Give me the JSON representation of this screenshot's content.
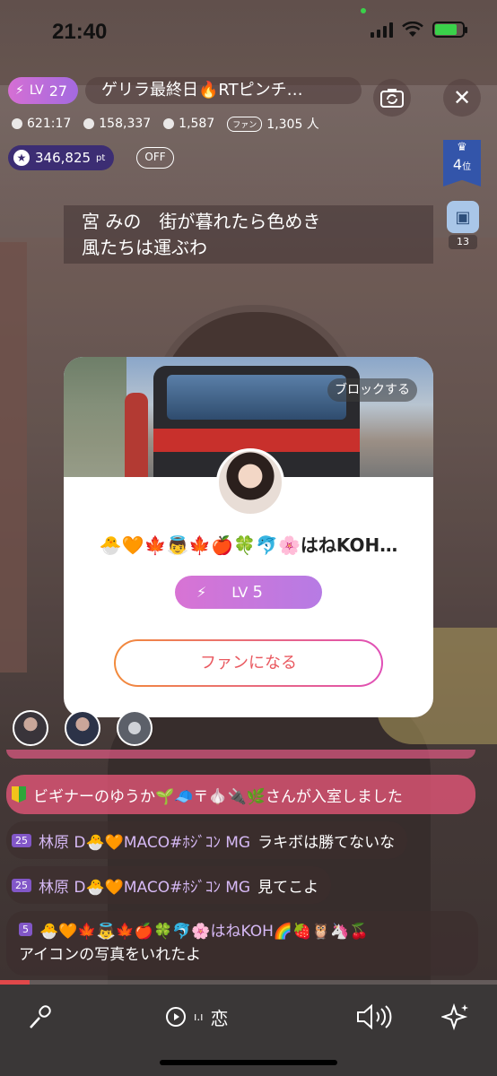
{
  "status": {
    "time": "21:40"
  },
  "header": {
    "level": "27",
    "level_prefix": "LV",
    "title": "ゲリラ最終日🔥RTピンチ…",
    "stats": {
      "duration": "621:17",
      "viewers": "158,337",
      "comments": "1,587",
      "fans_tag": "ファン",
      "fans": "1,305 人"
    },
    "points": "346,825",
    "points_unit": "pt",
    "off_label": "OFF",
    "rank": "4",
    "rank_unit": "位",
    "gift_count": "13"
  },
  "lyrics": {
    "line1": "宮 みの　街が暮れたら色めき",
    "line2": "風たちは運ぶわ"
  },
  "profile_modal": {
    "block_label": "ブロックする",
    "username": "🐣🧡🍁👼🍁🍎🍀🐬🌸はねKOH…",
    "level_prefix": "LV",
    "level": "5",
    "fan_button": "ファンになる"
  },
  "chat": [
    {
      "type": "join",
      "text": "ビギナーのゆうか🌱🧢〒🧄🔌🌿さんが入室しました"
    },
    {
      "type": "comment",
      "level": "25",
      "name": "林原 D🐣🧡MACO#ﾎｼﾞｺﾝ MG",
      "message": "ラキボは勝てないな"
    },
    {
      "type": "comment",
      "level": "25",
      "name": "林原 D🐣🧡MACO#ﾎｼﾞｺﾝ MG",
      "message": "見てこよ"
    },
    {
      "type": "comment",
      "level": "5",
      "name": "🐣🧡🍁👼🍁🍎🍀🐬🌸はねKOH🌈🍓🦉🦄🍒",
      "message": "アイコンの写真をいれたよ"
    }
  ],
  "bottom": {
    "song": "恋"
  },
  "colors": {
    "accent_purple": "#a36ae0",
    "join_pink": "#e55678",
    "fan_orange": "#f28a3a",
    "fan_pink": "#e04fb7"
  }
}
